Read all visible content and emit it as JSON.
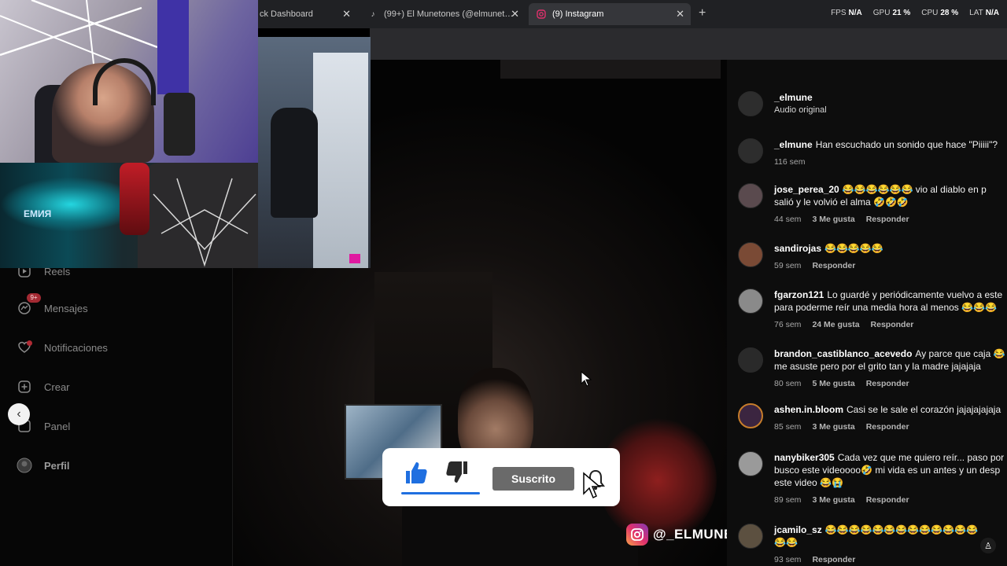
{
  "browser": {
    "tabs": [
      {
        "label": "ck Dashboard",
        "active": false
      },
      {
        "label": "(99+) El Munetones (@elmunet…",
        "active": false
      },
      {
        "label": "(9) Instagram",
        "active": true
      }
    ],
    "stats": [
      {
        "label": "FPS",
        "value": "N/A"
      },
      {
        "label": "GPU",
        "value": "21 %"
      },
      {
        "label": "CPU",
        "value": "28 %"
      },
      {
        "label": "LAT",
        "value": "N/A"
      }
    ]
  },
  "sidebar": {
    "items": [
      {
        "label": "Reels",
        "icon": "reels-icon"
      },
      {
        "label": "Mensajes",
        "icon": "messenger-icon",
        "badge": "9+"
      },
      {
        "label": "Notificaciones",
        "icon": "heart-icon"
      },
      {
        "label": "Crear",
        "icon": "plus-square-icon"
      },
      {
        "label": "Panel",
        "icon": "chart-icon"
      },
      {
        "label": "Perfil",
        "icon": "avatar-icon"
      }
    ]
  },
  "overlay": {
    "subscribe_label": "Suscrito",
    "like_color": "#1f6fe0"
  },
  "watermark": {
    "handle": "@_ELMUNE"
  },
  "post_header": {
    "user": "_elmune",
    "audio": "Audio original"
  },
  "comments": [
    {
      "user": "_elmune",
      "line1": "Han escuchado un sonido que hace \"Piiiii\"?",
      "line2": "",
      "time": "116 sem",
      "likes": "",
      "reply": ""
    },
    {
      "user": "jose_perea_20",
      "line1": "😂😂😂😂😂😂 vio al diablo en p",
      "line2": "salió y le volvió el alma 🤣🤣🤣",
      "time": "44 sem",
      "likes": "3 Me gusta",
      "reply": "Responder"
    },
    {
      "user": "sandirojas",
      "line1": "😂😂😂😂😂",
      "line2": "",
      "time": "59 sem",
      "likes": "",
      "reply": "Responder"
    },
    {
      "user": "fgarzon121",
      "line1": "Lo guardé y periódicamente vuelvo a este",
      "line2": "para poderme reír una media hora al menos 😂😂😂",
      "time": "76 sem",
      "likes": "24 Me gusta",
      "reply": "Responder"
    },
    {
      "user": "brandon_castiblanco_acevedo",
      "line1": "Ay parce que caja 😂 t",
      "line2": "me asuste pero por el grito tan y la madre jajajaja",
      "time": "80 sem",
      "likes": "5 Me gusta",
      "reply": "Responder"
    },
    {
      "user": "ashen.in.bloom",
      "line1": "Casi se le sale el corazón jajajajajaja",
      "line2": "",
      "time": "85 sem",
      "likes": "3 Me gusta",
      "reply": "Responder"
    },
    {
      "user": "nanybiker305",
      "line1": "Cada vez que me quiero reír... paso por",
      "line2": "busco este videoooo🤣 mi vida es un antes y un desp",
      "line3": "este video 😂😭",
      "time": "89 sem",
      "likes": "3 Me gusta",
      "reply": "Responder"
    },
    {
      "user": "jcamilo_sz",
      "line1": "😂😂😂😂😂😂😂😂😂😂😂😂😂",
      "line2": "😂😂",
      "time": "93 sem",
      "likes": "",
      "reply": "Responder"
    }
  ],
  "webcam": {
    "logo_text": "ЕМИЯ"
  }
}
